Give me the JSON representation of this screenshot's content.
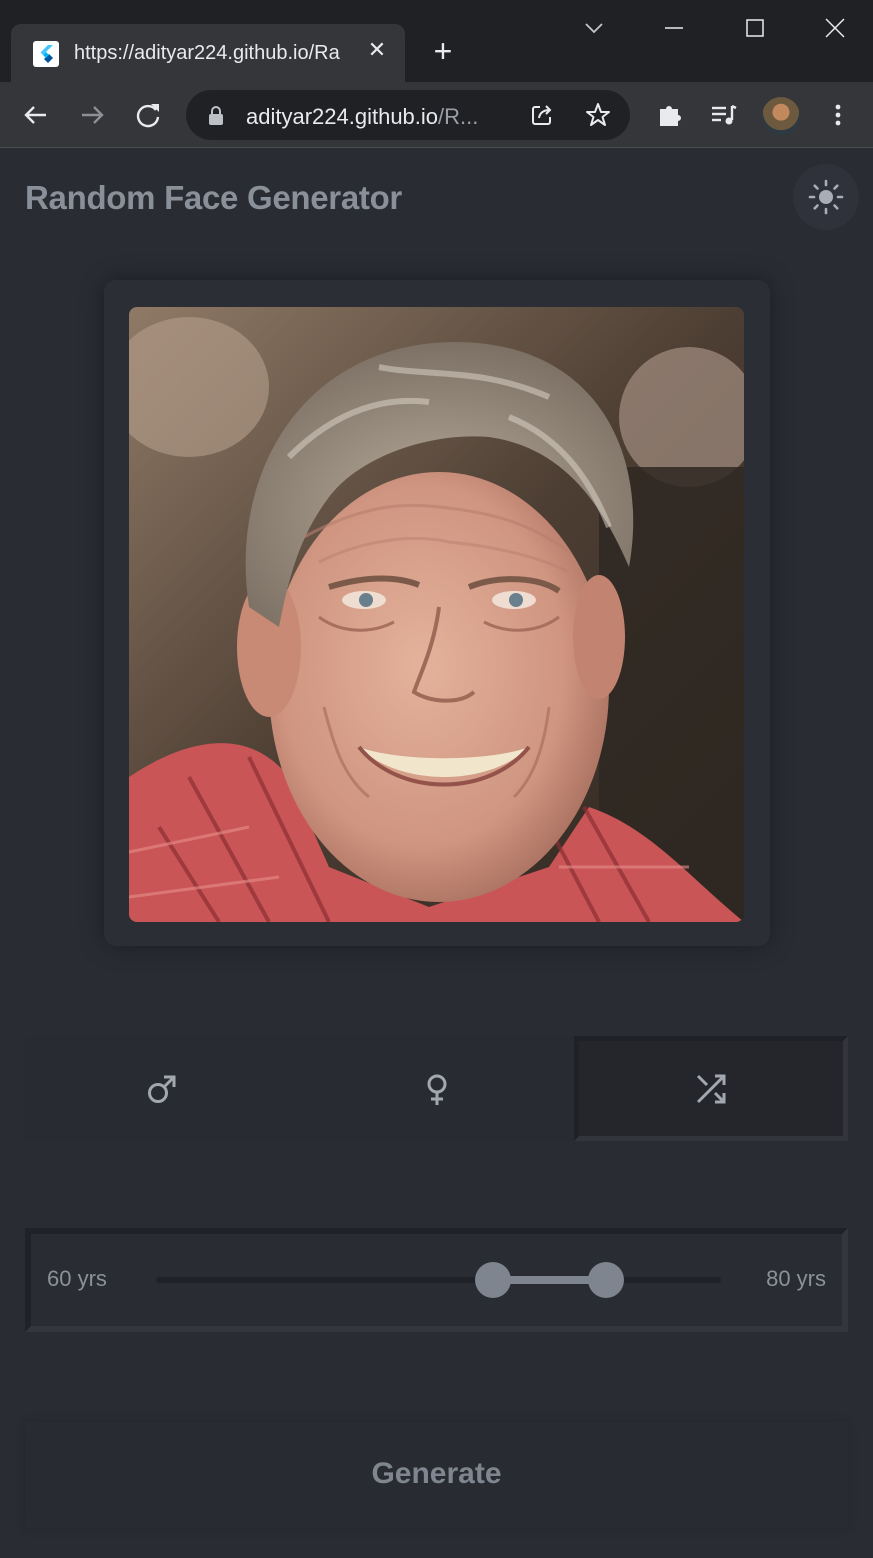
{
  "browser": {
    "tab_title": "https://adityar224.github.io/Ra",
    "close_glyph": "✕",
    "new_tab_glyph": "+",
    "url_host": "adityar224.github.io",
    "url_rest": "/R..."
  },
  "app": {
    "title": "Random Face Generator",
    "theme_icon": "sun-icon"
  },
  "gender_options": [
    {
      "name": "male",
      "icon": "male-icon",
      "selected": false
    },
    {
      "name": "female",
      "icon": "female-icon",
      "selected": false
    },
    {
      "name": "random",
      "icon": "shuffle-icon",
      "selected": true
    }
  ],
  "age_range": {
    "min_label": "60 yrs",
    "max_label": "80 yrs",
    "low": 60,
    "high": 80
  },
  "generate": {
    "label": "Generate"
  },
  "colors": {
    "background": "#292c33",
    "muted_text": "#8a9099",
    "slider_active": "#7e858f"
  }
}
